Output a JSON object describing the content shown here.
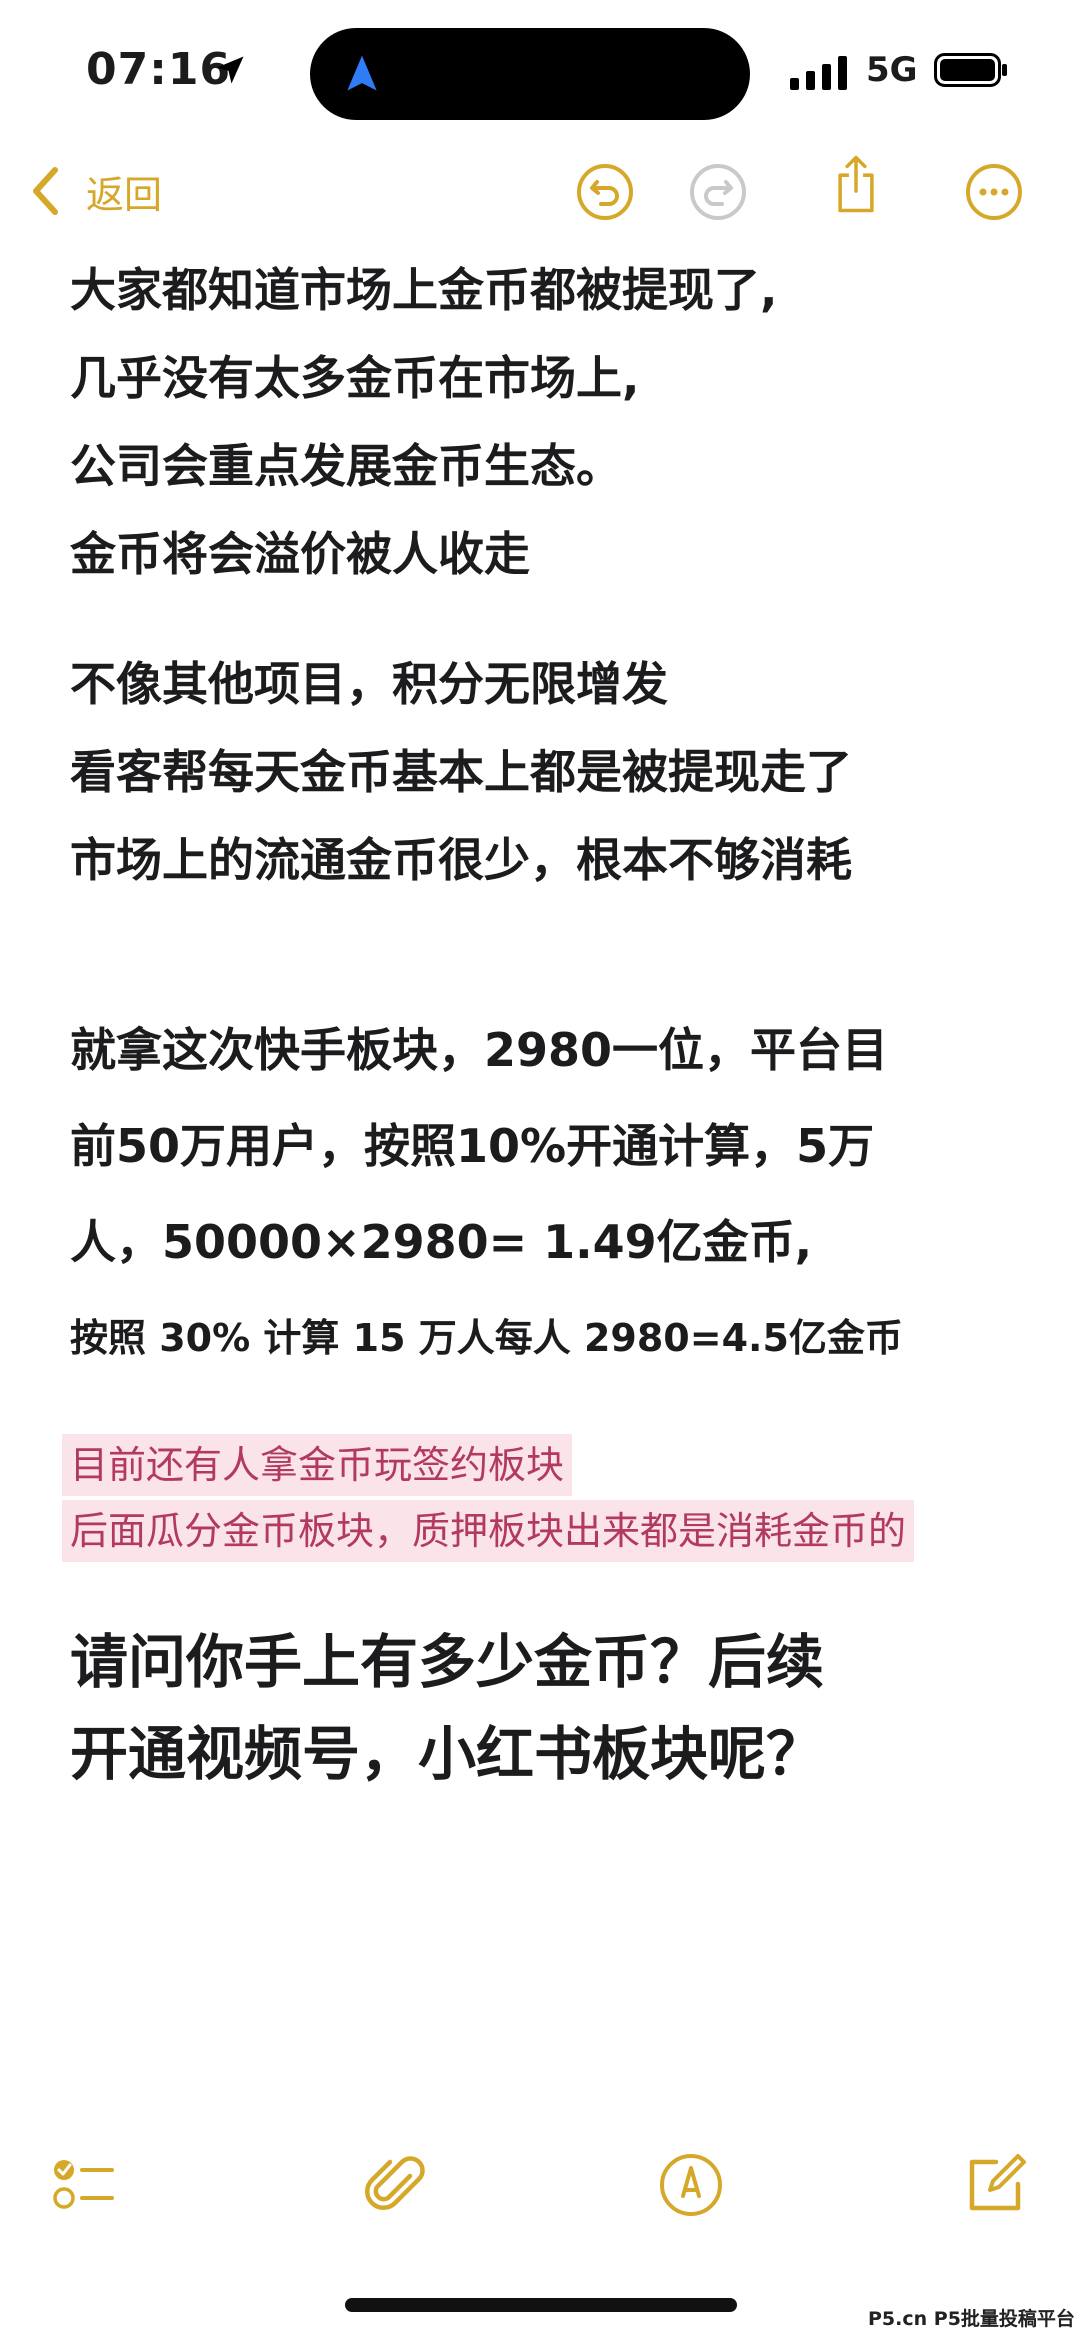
{
  "status_bar": {
    "time": "07:16",
    "network": "5G"
  },
  "nav": {
    "back_label": "返回"
  },
  "content": {
    "para1": [
      "大家都知道市场上金币都被提现了,",
      "几乎没有太多金币在市场上,",
      "公司会重点发展金币生态。",
      "金币将会溢价被人收走"
    ],
    "para2": [
      "不像其他项目，积分无限增发",
      "看客帮每天金币基本上都是被提现走了",
      "市场上的流通金币很少，根本不够消耗"
    ],
    "para3": [
      "就拿这次快手板块，2980一位，平台目",
      "前50万用户，按照10%开通计算，5万",
      "人，50000×2980= 1.49亿金币,"
    ],
    "para3_small": "按照 30% 计算 15 万人每人 2980=4.5亿金币",
    "highlight": [
      "目前还有人拿金币玩签约板块",
      "后面瓜分金币板块，质押板块出来都是消耗金币的"
    ],
    "question": [
      "请问你手上有多少金币？后续",
      "开通视频号，小红书板块呢？"
    ]
  },
  "watermark": "P5.cn P5批量投稿平台",
  "colors": {
    "accent": "#d6a82a",
    "highlight_text": "#b23a5f",
    "highlight_bg": "#fbe3ea"
  }
}
